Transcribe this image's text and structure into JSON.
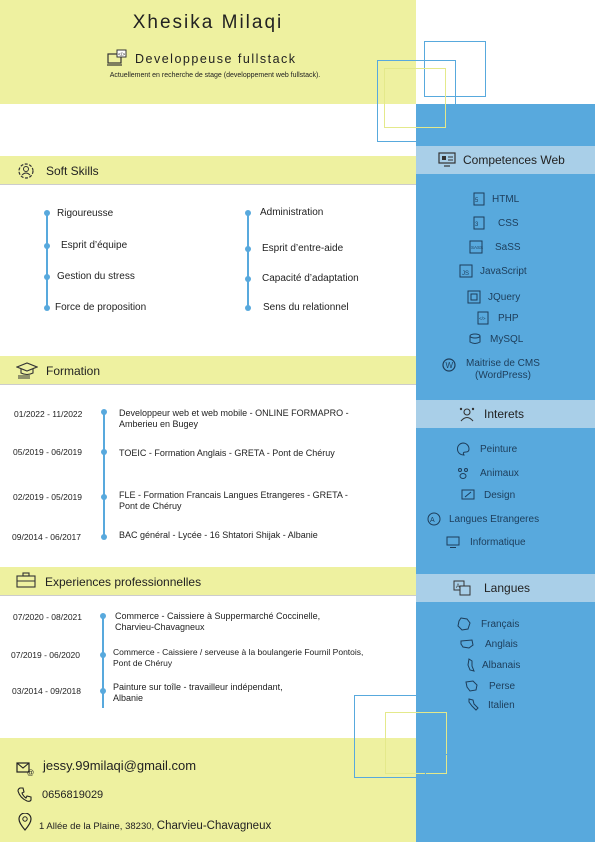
{
  "header": {
    "name": "Xhesika Milaqi",
    "job_title": "Developpeuse fullstack",
    "job_subtitle": "Actuellement en recherche de stage (developpement web fullstack)."
  },
  "competences": {
    "title": "Competences Web",
    "items": [
      {
        "label": "HTML",
        "icon": "html-icon"
      },
      {
        "label": "CSS",
        "icon": "css-icon"
      },
      {
        "label": "SaSS",
        "icon": "sass-icon"
      },
      {
        "label": "JavaScript",
        "icon": "javascript-icon"
      },
      {
        "label": "JQuery",
        "icon": "jquery-icon"
      },
      {
        "label": "PHP",
        "icon": "php-icon"
      },
      {
        "label": "MySQL",
        "icon": "mysql-icon"
      },
      {
        "label": "Maitrise de CMS\n(WordPress)",
        "icon": "wordpress-icon"
      }
    ]
  },
  "interets": {
    "title": "Interets",
    "items": [
      {
        "label": "Peinture",
        "icon": "palette-icon"
      },
      {
        "label": "Animaux",
        "icon": "paw-icon"
      },
      {
        "label": "Design",
        "icon": "design-icon"
      },
      {
        "label": "Langues Etrangeres",
        "icon": "languages-icon"
      },
      {
        "label": "Informatique",
        "icon": "computer-icon"
      }
    ]
  },
  "langues": {
    "title": "Langues",
    "items": [
      {
        "label": "Français",
        "icon": "france-map-icon"
      },
      {
        "label": "Anglais",
        "icon": "usa-map-icon"
      },
      {
        "label": "Albanais",
        "icon": "albania-map-icon"
      },
      {
        "label": "Perse",
        "icon": "iran-map-icon"
      },
      {
        "label": "Italien",
        "icon": "italy-map-icon"
      }
    ]
  },
  "soft_skills": {
    "title": "Soft Skills",
    "left": [
      "Rigoureusse",
      "Esprit d’équipe",
      "Gestion du stress",
      "Force de proposition"
    ],
    "right": [
      "Administration",
      "Esprit d’entre-aide",
      "Capacité d’adaptation",
      "Sens du relationnel"
    ]
  },
  "formation": {
    "title": "Formation",
    "entries": [
      {
        "date": "01/2022 - 11/2022",
        "text": "Developpeur web et web mobile - ONLINE FORMAPRO -\nAmberieu en Bugey"
      },
      {
        "date": "05/2019 - 06/2019",
        "text": "TOEIC - Formation Anglais - GRETA - Pont de Chéruy"
      },
      {
        "date": "02/2019 - 05/2019",
        "text": "FLE - Formation Francais Langues Etrangeres - GRETA -\nPont de Chéruy"
      },
      {
        "date": "09/2014 - 06/2017",
        "text": "BAC général - Lycée - 16 Shtatori Shijak - Albanie"
      }
    ]
  },
  "experiences": {
    "title": "Experiences professionnelles",
    "entries": [
      {
        "date": "07/2020 - 08/2021",
        "text": "Commerce - Caissiere à Suppermarché Coccinelle,\nCharvieu-Chavagneux"
      },
      {
        "date": "07/2019 - 06/2020",
        "text": "Commerce - Caissiere / serveuse à la boulangerie Fournil Pontois,\nPont de Chéruy"
      },
      {
        "date": "03/2014 - 09/2018",
        "text": "Painture sur toîle - travailleur indépendant,\nAlbanie"
      }
    ]
  },
  "contact": {
    "email": "jessy.99milaqi@gmail.com",
    "phone": "0656819029",
    "address_prefix": "1 Allée de la Plaine, 38230, ",
    "address_city": "Charvieu-Chavagneux"
  },
  "colors": {
    "yellow": "#eef1a0",
    "blue": "#58a9dd",
    "light_blue": "#a9cfe8"
  }
}
